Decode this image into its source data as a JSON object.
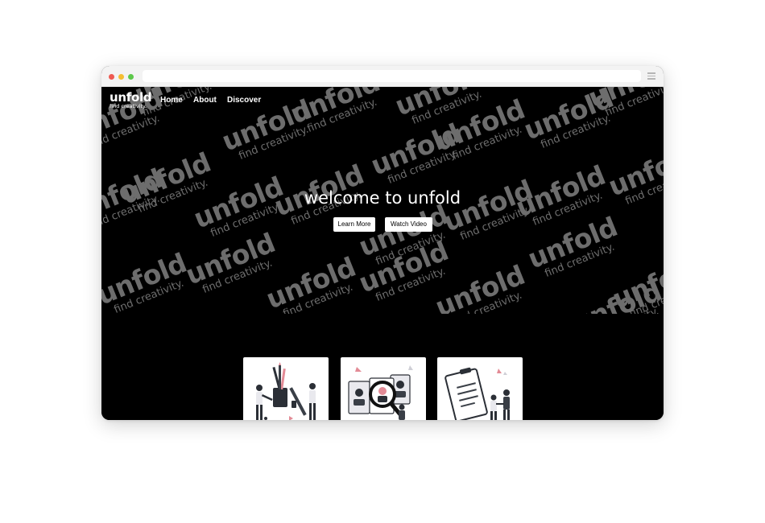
{
  "logo": {
    "name": "unfold",
    "tagline": "find creativity."
  },
  "nav": {
    "links": [
      "Home",
      "About",
      "Discover"
    ]
  },
  "hero": {
    "title": "welcome to unfold",
    "buttons": [
      "Learn More",
      "Watch Video"
    ],
    "watermark_word": "unfold",
    "watermark_tagline": "find creativity."
  },
  "browser": {
    "window_controls": [
      "close",
      "minimize",
      "maximize"
    ],
    "control_colors": [
      "#ee5a52",
      "#f5be32",
      "#5cc84a"
    ],
    "menu_icon": "hamburger-icon"
  },
  "cards": [
    {
      "illustration": "art-supplies-illustration"
    },
    {
      "illustration": "magnifier-search-illustration"
    },
    {
      "illustration": "clipboard-meeting-illustration"
    }
  ],
  "colors": {
    "background": "#000000",
    "watermark": "#6d6d6d",
    "accent": "#e38b96"
  }
}
